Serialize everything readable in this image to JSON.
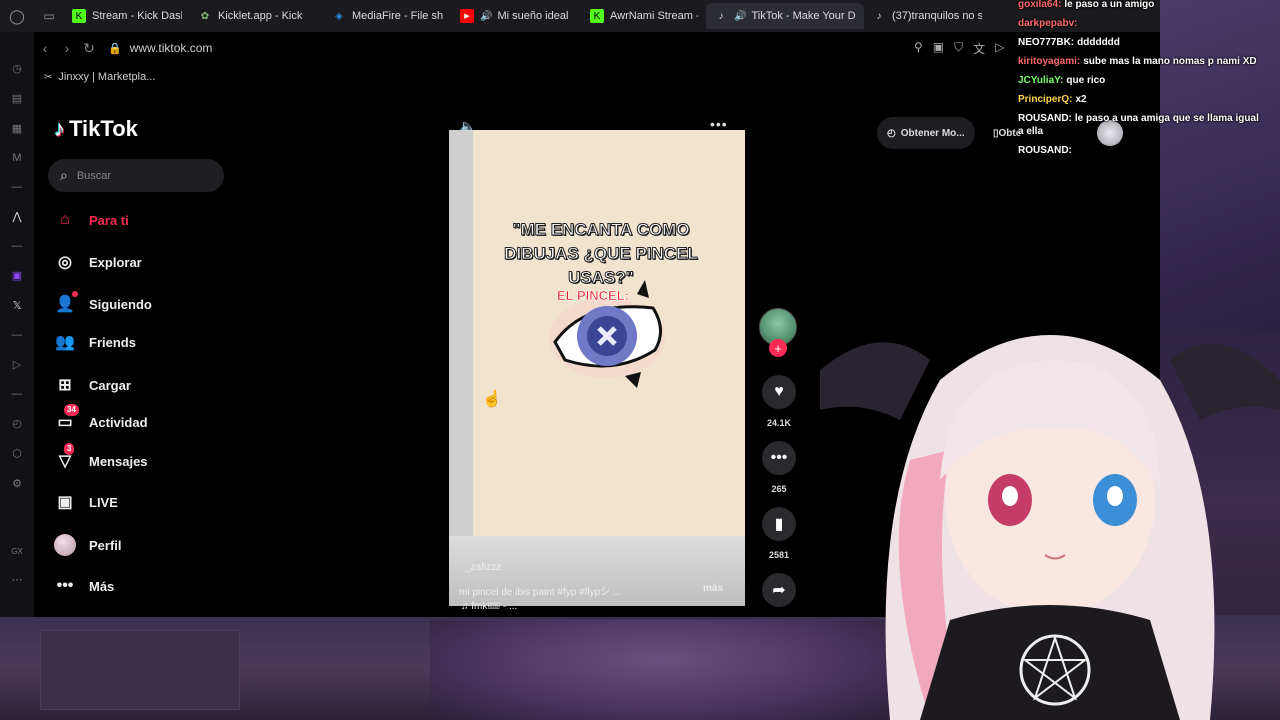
{
  "tabs": [
    {
      "label": "Stream - Kick Dash",
      "icon": "kick-icon",
      "color": "#53fc18",
      "active": false
    },
    {
      "label": "Kicklet.app - Kick",
      "icon": "kicklet-icon",
      "color": "#7cc46a",
      "active": false
    },
    {
      "label": "MediaFire - File sh",
      "icon": "mediafire-icon",
      "color": "#2f8de0",
      "active": false
    },
    {
      "label": "Mi sueño ideal",
      "icon": "youtube-icon",
      "color": "#ff0000",
      "active": false,
      "audio": true
    },
    {
      "label": "AwrNami Stream -",
      "icon": "kick-icon",
      "color": "#53fc18",
      "active": false
    },
    {
      "label": "TikTok - Make Your D",
      "icon": "tiktok-icon",
      "color": "#ffffff",
      "active": true,
      "audio": true
    },
    {
      "label": "(37)tranquilos no s",
      "icon": "tiktok-icon",
      "color": "#ffffff",
      "active": false
    }
  ],
  "address": {
    "url": "www.tiktok.com"
  },
  "bookmarks": {
    "item": "Jinxxy | Marketpla..."
  },
  "tiktok": {
    "logo": "TikTok",
    "search_placeholder": "Buscar",
    "nav": [
      {
        "label": "Para ti",
        "icon": "home-icon",
        "active": true
      },
      {
        "label": "Explorar",
        "icon": "compass-icon"
      },
      {
        "label": "Siguiendo",
        "icon": "following-icon"
      },
      {
        "label": "Friends",
        "icon": "friends-icon"
      },
      {
        "label": "Cargar",
        "icon": "upload-icon"
      },
      {
        "label": "Actividad",
        "icon": "activity-icon",
        "badge": "34"
      },
      {
        "label": "Mensajes",
        "icon": "messages-icon",
        "badge": "3"
      },
      {
        "label": "LIVE",
        "icon": "live-icon"
      },
      {
        "label": "Perfil",
        "icon": "profile-avatar"
      },
      {
        "label": "Más",
        "icon": "more-icon"
      }
    ],
    "get_app": "Obtener Mo...",
    "get_app_2": "Obte",
    "video": {
      "overlay_text": "\"ME ENCANTA COMO DIBUJAS ¿QUE PINCEL USAS?\"",
      "overlay_sub": "EL PINCEL:",
      "author": "_zafizzz",
      "caption": "mi pincel de ibis paint  #fyp  #flypシ ...",
      "more": "más",
      "music": "♫ fmk🎟 - ..."
    },
    "actions": {
      "likes": "24.1K",
      "comments": "265",
      "saves": "2581"
    }
  },
  "chat": [
    {
      "user": "goxila64:",
      "text": "le paso a un amigo",
      "color": "#ff6b6b"
    },
    {
      "user": "darkpepabv:",
      "text": "",
      "color": "#ff6b6b"
    },
    {
      "user": "NEO777BK:",
      "text": "ddddddd",
      "color": "#ffffff"
    },
    {
      "user": "kiritoyagami:",
      "text": "sube mas la mano nomas p nami XD",
      "color": "#ff6b6b"
    },
    {
      "user": "JCYuliaY:",
      "text": "que rico",
      "color": "#7cff6b"
    },
    {
      "user": "PrinciperQ:",
      "text": "x2",
      "color": "#ffd34d"
    },
    {
      "user": "ROUSAND:",
      "text": "le paso a una amiga que se llama igual a ella",
      "color": "#ffffff"
    },
    {
      "user": "ROUSAND:",
      "text": "",
      "color": "#ffffff"
    }
  ]
}
